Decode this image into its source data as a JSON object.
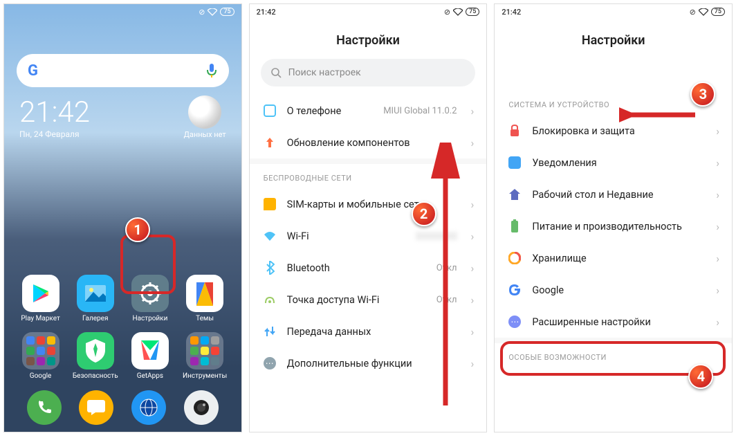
{
  "status": {
    "time": "21:42",
    "battery": "75"
  },
  "phone1": {
    "time": "21:42",
    "date": "Пн, 24 Февраля",
    "weather": "Данных нет",
    "apps": [
      {
        "label": "Play Маркет"
      },
      {
        "label": "Галерея"
      },
      {
        "label": "Настройки"
      },
      {
        "label": "Темы"
      },
      {
        "label": "Google"
      },
      {
        "label": "Безопасность"
      },
      {
        "label": "GetApps"
      },
      {
        "label": "Инструменты"
      }
    ],
    "badge": "1"
  },
  "phone2": {
    "title": "Настройки",
    "search_placeholder": "Поиск настроек",
    "about_label": "О телефоне",
    "about_value": "MIUI Global 11.0.2",
    "updates_label": "Обновление компонентов",
    "section_wireless": "БЕСПРОВОДНЫЕ СЕТИ",
    "sim_label": "SIM-карты и мобильные сети",
    "wifi_label": "Wi-Fi",
    "wifi_value": "",
    "bt_label": "Bluetooth",
    "bt_value": "Откл",
    "hotspot_label": "Точка доступа Wi-Fi",
    "hotspot_value": "Откл",
    "data_label": "Передача данных",
    "more_label": "Дополнительные функции",
    "badge": "2"
  },
  "phone3": {
    "title": "Настройки",
    "section_system": "СИСТЕМА И УСТРОЙСТВО",
    "lock_label": "Блокировка и защита",
    "notif_label": "Уведомления",
    "home_label": "Рабочий стол и Недавние",
    "power_label": "Питание и производительность",
    "storage_label": "Хранилище",
    "google_label": "Google",
    "advanced_label": "Расширенные настройки",
    "section_special": "ОСОБЫЕ ВОЗМОЖНОСТИ",
    "badge3": "3",
    "badge4": "4"
  }
}
